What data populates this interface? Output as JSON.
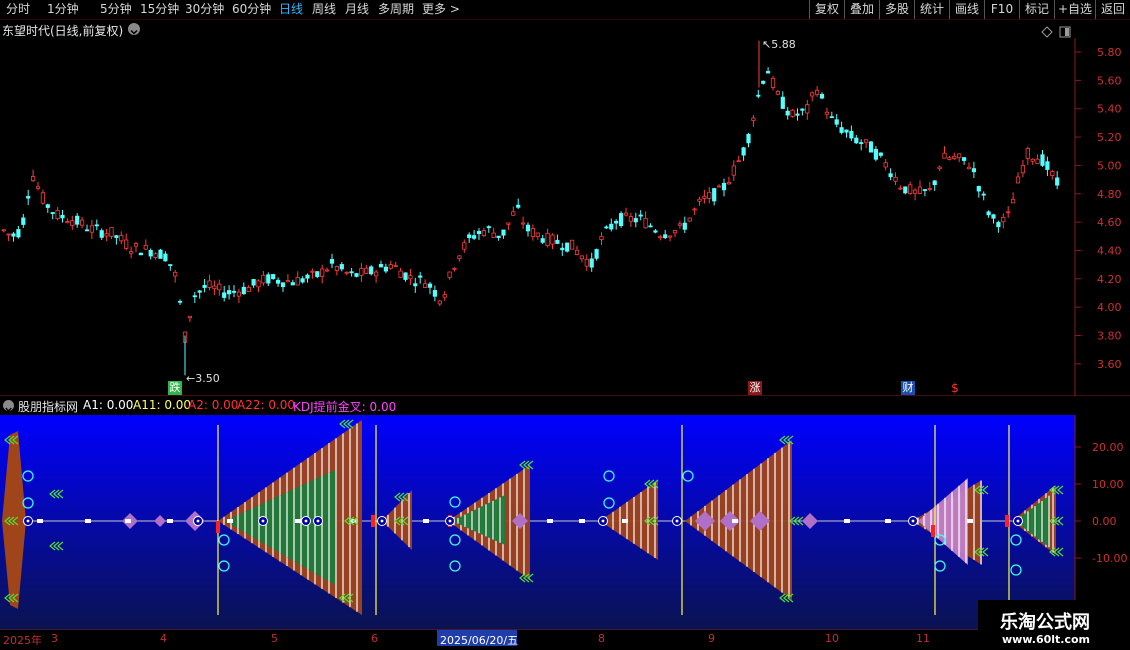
{
  "toolbar": {
    "periods": [
      "分时",
      "1分钟",
      "5分钟",
      "15分钟",
      "30分钟",
      "60分钟",
      "日线",
      "周线",
      "月线",
      "多周期",
      "更多 >"
    ],
    "active_period": "日线",
    "right_buttons": [
      "复权",
      "叠加",
      "多股",
      "统计",
      "画线",
      "F10",
      "标记",
      "+自选",
      "返回"
    ]
  },
  "main_chart": {
    "title": "东望时代(日线,前复权)",
    "high_label": "5.88",
    "low_label": "3.50",
    "y_axis_ticks": [
      "5.80",
      "5.60",
      "5.40",
      "5.20",
      "5.00",
      "4.80",
      "4.60",
      "4.40",
      "4.20",
      "4.00",
      "3.80",
      "3.60"
    ],
    "markers": [
      {
        "text": "跌",
        "color": "#2fb64a",
        "text_color": "#ffffff"
      },
      {
        "text": "涨",
        "color": "#8a1a1a",
        "text_color": "#ffffff"
      },
      {
        "text": "财",
        "color": "#1b4fae",
        "text_color": "#ffffff"
      },
      {
        "text": "$",
        "color": "#000000",
        "text_color": "#ff3030"
      }
    ]
  },
  "indicator": {
    "name": "股朋指标网",
    "items": [
      {
        "text": "A1: 0.00",
        "color": "#ffffff"
      },
      {
        "text": "A11: 0.00",
        "color": "#ffff66"
      },
      {
        "text": "A2: 0.00",
        "color": "#ff3333"
      },
      {
        "text": "A22: 0.00",
        "color": "#ff3333"
      },
      {
        "text": "KDJ提前金叉: 0.00",
        "color": "#ff44ff"
      }
    ],
    "y_axis_ticks": [
      "20.00",
      "10.00",
      "0.00",
      "-10.00"
    ]
  },
  "date_axis": {
    "labels": [
      "2025年",
      "3",
      "4",
      "5",
      "6",
      "2025/06/20/五",
      "8",
      "9",
      "10",
      "11"
    ]
  },
  "watermark": {
    "title": "乐淘公式网",
    "url": "www.60lt.com"
  },
  "colors": {
    "up": "#ff3b3b",
    "down": "#54ffff",
    "axis": "#8b1a1a",
    "indicator_top": "#0000ff",
    "indicator_bottom": "#0a1350"
  }
}
